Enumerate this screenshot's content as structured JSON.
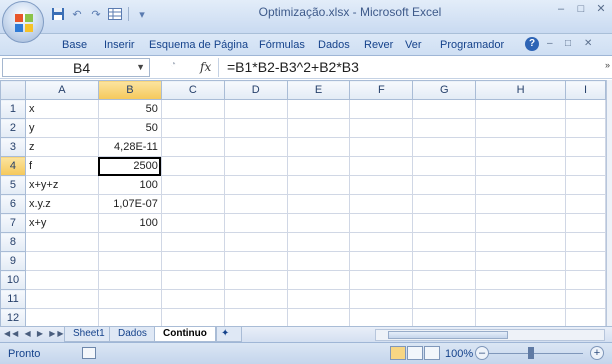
{
  "window": {
    "title": "Optimização.xlsx - Microsoft Excel",
    "controls": {
      "minimize": "–",
      "maximize": "□",
      "close": "✕"
    }
  },
  "qat": {
    "save_icon": "save-icon",
    "undo_icon": "undo-icon",
    "redo_icon": "redo-icon",
    "customize": "▾"
  },
  "ribbon": {
    "tabs": [
      "Base",
      "Inserir",
      "Esquema de Página",
      "Fórmulas",
      "Dados",
      "Rever",
      "Ver",
      "Programador"
    ],
    "help": "?"
  },
  "formula_bar": {
    "name_box": "B4",
    "fx": "fx",
    "formula": "=B1*B2-B3^2+B2*B3"
  },
  "grid": {
    "columns": [
      "A",
      "B",
      "C",
      "D",
      "E",
      "F",
      "G",
      "H",
      "I"
    ],
    "rows": [
      {
        "n": "1",
        "a": "x",
        "b": "50"
      },
      {
        "n": "2",
        "a": "y",
        "b": "50"
      },
      {
        "n": "3",
        "a": "z",
        "b": "4,28E-11"
      },
      {
        "n": "4",
        "a": "f",
        "b": "2500"
      },
      {
        "n": "5",
        "a": "x+y+z",
        "b": "100"
      },
      {
        "n": "6",
        "a": "x.y.z",
        "b": "1,07E-07"
      },
      {
        "n": "7",
        "a": "x+y",
        "b": "100"
      },
      {
        "n": "8",
        "a": "",
        "b": ""
      },
      {
        "n": "9",
        "a": "",
        "b": ""
      },
      {
        "n": "10",
        "a": "",
        "b": ""
      },
      {
        "n": "11",
        "a": "",
        "b": ""
      },
      {
        "n": "12",
        "a": "",
        "b": ""
      }
    ],
    "selected_cell": "B4"
  },
  "sheets": {
    "tabs": [
      "Sheet1",
      "Dados",
      "Continuo"
    ],
    "active": "Continuo"
  },
  "status": {
    "mode": "Pronto",
    "zoom": "100%",
    "zoom_minus": "–",
    "zoom_plus": "+"
  },
  "colors": {
    "selection_header": "#f5c85a",
    "ribbon_text": "#15428b",
    "grid_line": "#d0d7e5"
  }
}
